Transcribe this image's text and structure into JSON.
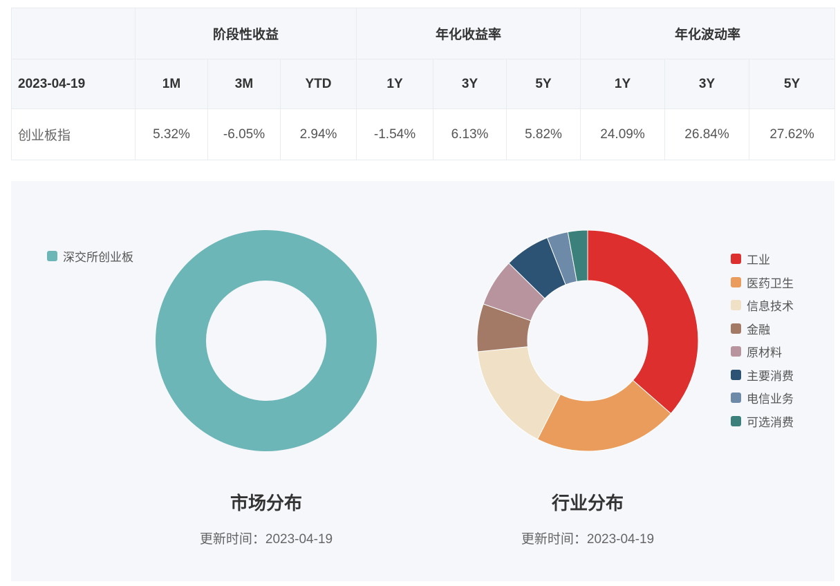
{
  "table": {
    "groups": [
      "阶段性收益",
      "年化收益率",
      "年化波动率"
    ],
    "date": "2023-04-19",
    "periods": [
      "1M",
      "3M",
      "YTD",
      "1Y",
      "3Y",
      "5Y",
      "1Y",
      "3Y",
      "5Y"
    ],
    "index_name": "创业板指",
    "values": [
      "5.32%",
      "-6.05%",
      "2.94%",
      "-1.54%",
      "6.13%",
      "5.82%",
      "24.09%",
      "26.84%",
      "27.62%"
    ]
  },
  "chart_data": [
    {
      "type": "pie",
      "title": "市场分布",
      "subtitle": "更新时间：2023-04-19",
      "legend_position": "top-left",
      "slices": [
        {
          "name": "深交所创业板",
          "value": 100,
          "color": "#6cb6b7"
        }
      ]
    },
    {
      "type": "pie",
      "title": "行业分布",
      "subtitle": "更新时间：2023-04-19",
      "legend_position": "right",
      "slices": [
        {
          "name": "工业",
          "value": 35.5,
          "color": "#dc2f2e"
        },
        {
          "name": "医药卫生",
          "value": 20.5,
          "color": "#e99c5c"
        },
        {
          "name": "信息技术",
          "value": 15.5,
          "color": "#efe0c6"
        },
        {
          "name": "金融",
          "value": 6.8,
          "color": "#a37a65"
        },
        {
          "name": "原材料",
          "value": 6.8,
          "color": "#b8959e"
        },
        {
          "name": "主要消费",
          "value": 6.5,
          "color": "#2d5374"
        },
        {
          "name": "电信业务",
          "value": 3.0,
          "color": "#6e8aa9"
        },
        {
          "name": "可选消费",
          "value": 2.8,
          "color": "#3b807a"
        }
      ]
    }
  ]
}
